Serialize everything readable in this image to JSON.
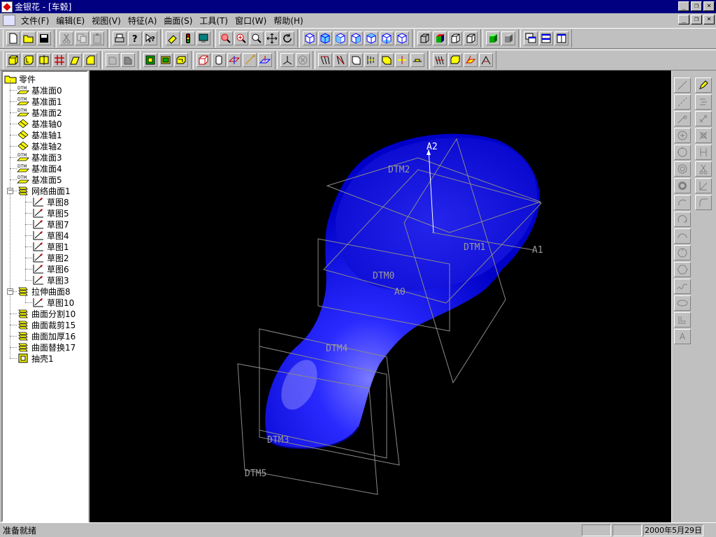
{
  "window": {
    "title": "金银花 - [车毂]",
    "min_glyph": "_",
    "restore_glyph": "❐",
    "close_glyph": "×"
  },
  "menu": [
    "文件(F)",
    "编辑(E)",
    "视图(V)",
    "特征(A)",
    "曲面(S)",
    "工具(T)",
    "窗口(W)",
    "帮助(H)"
  ],
  "tree": {
    "root": "零件",
    "items": [
      {
        "label": "基准面0",
        "icon": "datum-plane-icon",
        "level": 1
      },
      {
        "label": "基准面1",
        "icon": "datum-plane-icon",
        "level": 1
      },
      {
        "label": "基准面2",
        "icon": "datum-plane-icon",
        "level": 1
      },
      {
        "label": "基准轴0",
        "icon": "datum-axis-icon",
        "level": 1
      },
      {
        "label": "基准轴1",
        "icon": "datum-axis-icon",
        "level": 1
      },
      {
        "label": "基准轴2",
        "icon": "datum-axis-icon",
        "level": 1
      },
      {
        "label": "基准面3",
        "icon": "datum-plane-icon",
        "level": 1
      },
      {
        "label": "基准面4",
        "icon": "datum-plane-icon",
        "level": 1
      },
      {
        "label": "基准面5",
        "icon": "datum-plane-icon",
        "level": 1
      },
      {
        "label": "网络曲面1",
        "icon": "surface-icon",
        "level": 1,
        "expanded": true
      },
      {
        "label": "草图8",
        "icon": "sketch-icon",
        "level": 2
      },
      {
        "label": "草图5",
        "icon": "sketch-icon",
        "level": 2
      },
      {
        "label": "草图7",
        "icon": "sketch-icon",
        "level": 2
      },
      {
        "label": "草图4",
        "icon": "sketch-icon",
        "level": 2
      },
      {
        "label": "草图1",
        "icon": "sketch-icon",
        "level": 2
      },
      {
        "label": "草图2",
        "icon": "sketch-icon",
        "level": 2
      },
      {
        "label": "草图6",
        "icon": "sketch-icon",
        "level": 2
      },
      {
        "label": "草图3",
        "icon": "sketch-icon",
        "level": 2
      },
      {
        "label": "拉伸曲面8",
        "icon": "surface-icon",
        "level": 1,
        "expanded": true
      },
      {
        "label": "草图10",
        "icon": "sketch-icon",
        "level": 2
      },
      {
        "label": "曲面分割10",
        "icon": "surface-icon",
        "level": 1
      },
      {
        "label": "曲面裁剪15",
        "icon": "surface-icon",
        "level": 1
      },
      {
        "label": "曲面加厚16",
        "icon": "surface-icon",
        "level": 1
      },
      {
        "label": "曲面替换17",
        "icon": "surface-icon",
        "level": 1
      },
      {
        "label": "抽壳1",
        "icon": "shell-icon",
        "level": 1
      }
    ],
    "dtm_glyph": "DTM"
  },
  "viewport": {
    "labels": {
      "A2": "A2",
      "A1": "A1",
      "A0": "A0",
      "DTM0": "DTM0",
      "DTM1": "DTM1",
      "DTM2": "DTM2",
      "DTM3": "DTM3",
      "DTM4": "DTM4",
      "DTM5": "DTM5"
    },
    "body_color": "#1010e0",
    "plane_color": "#8a8a8a"
  },
  "right_palette": {
    "text_tool": "A"
  },
  "status": {
    "text": "准备就绪",
    "date": "2000年5月29日"
  }
}
